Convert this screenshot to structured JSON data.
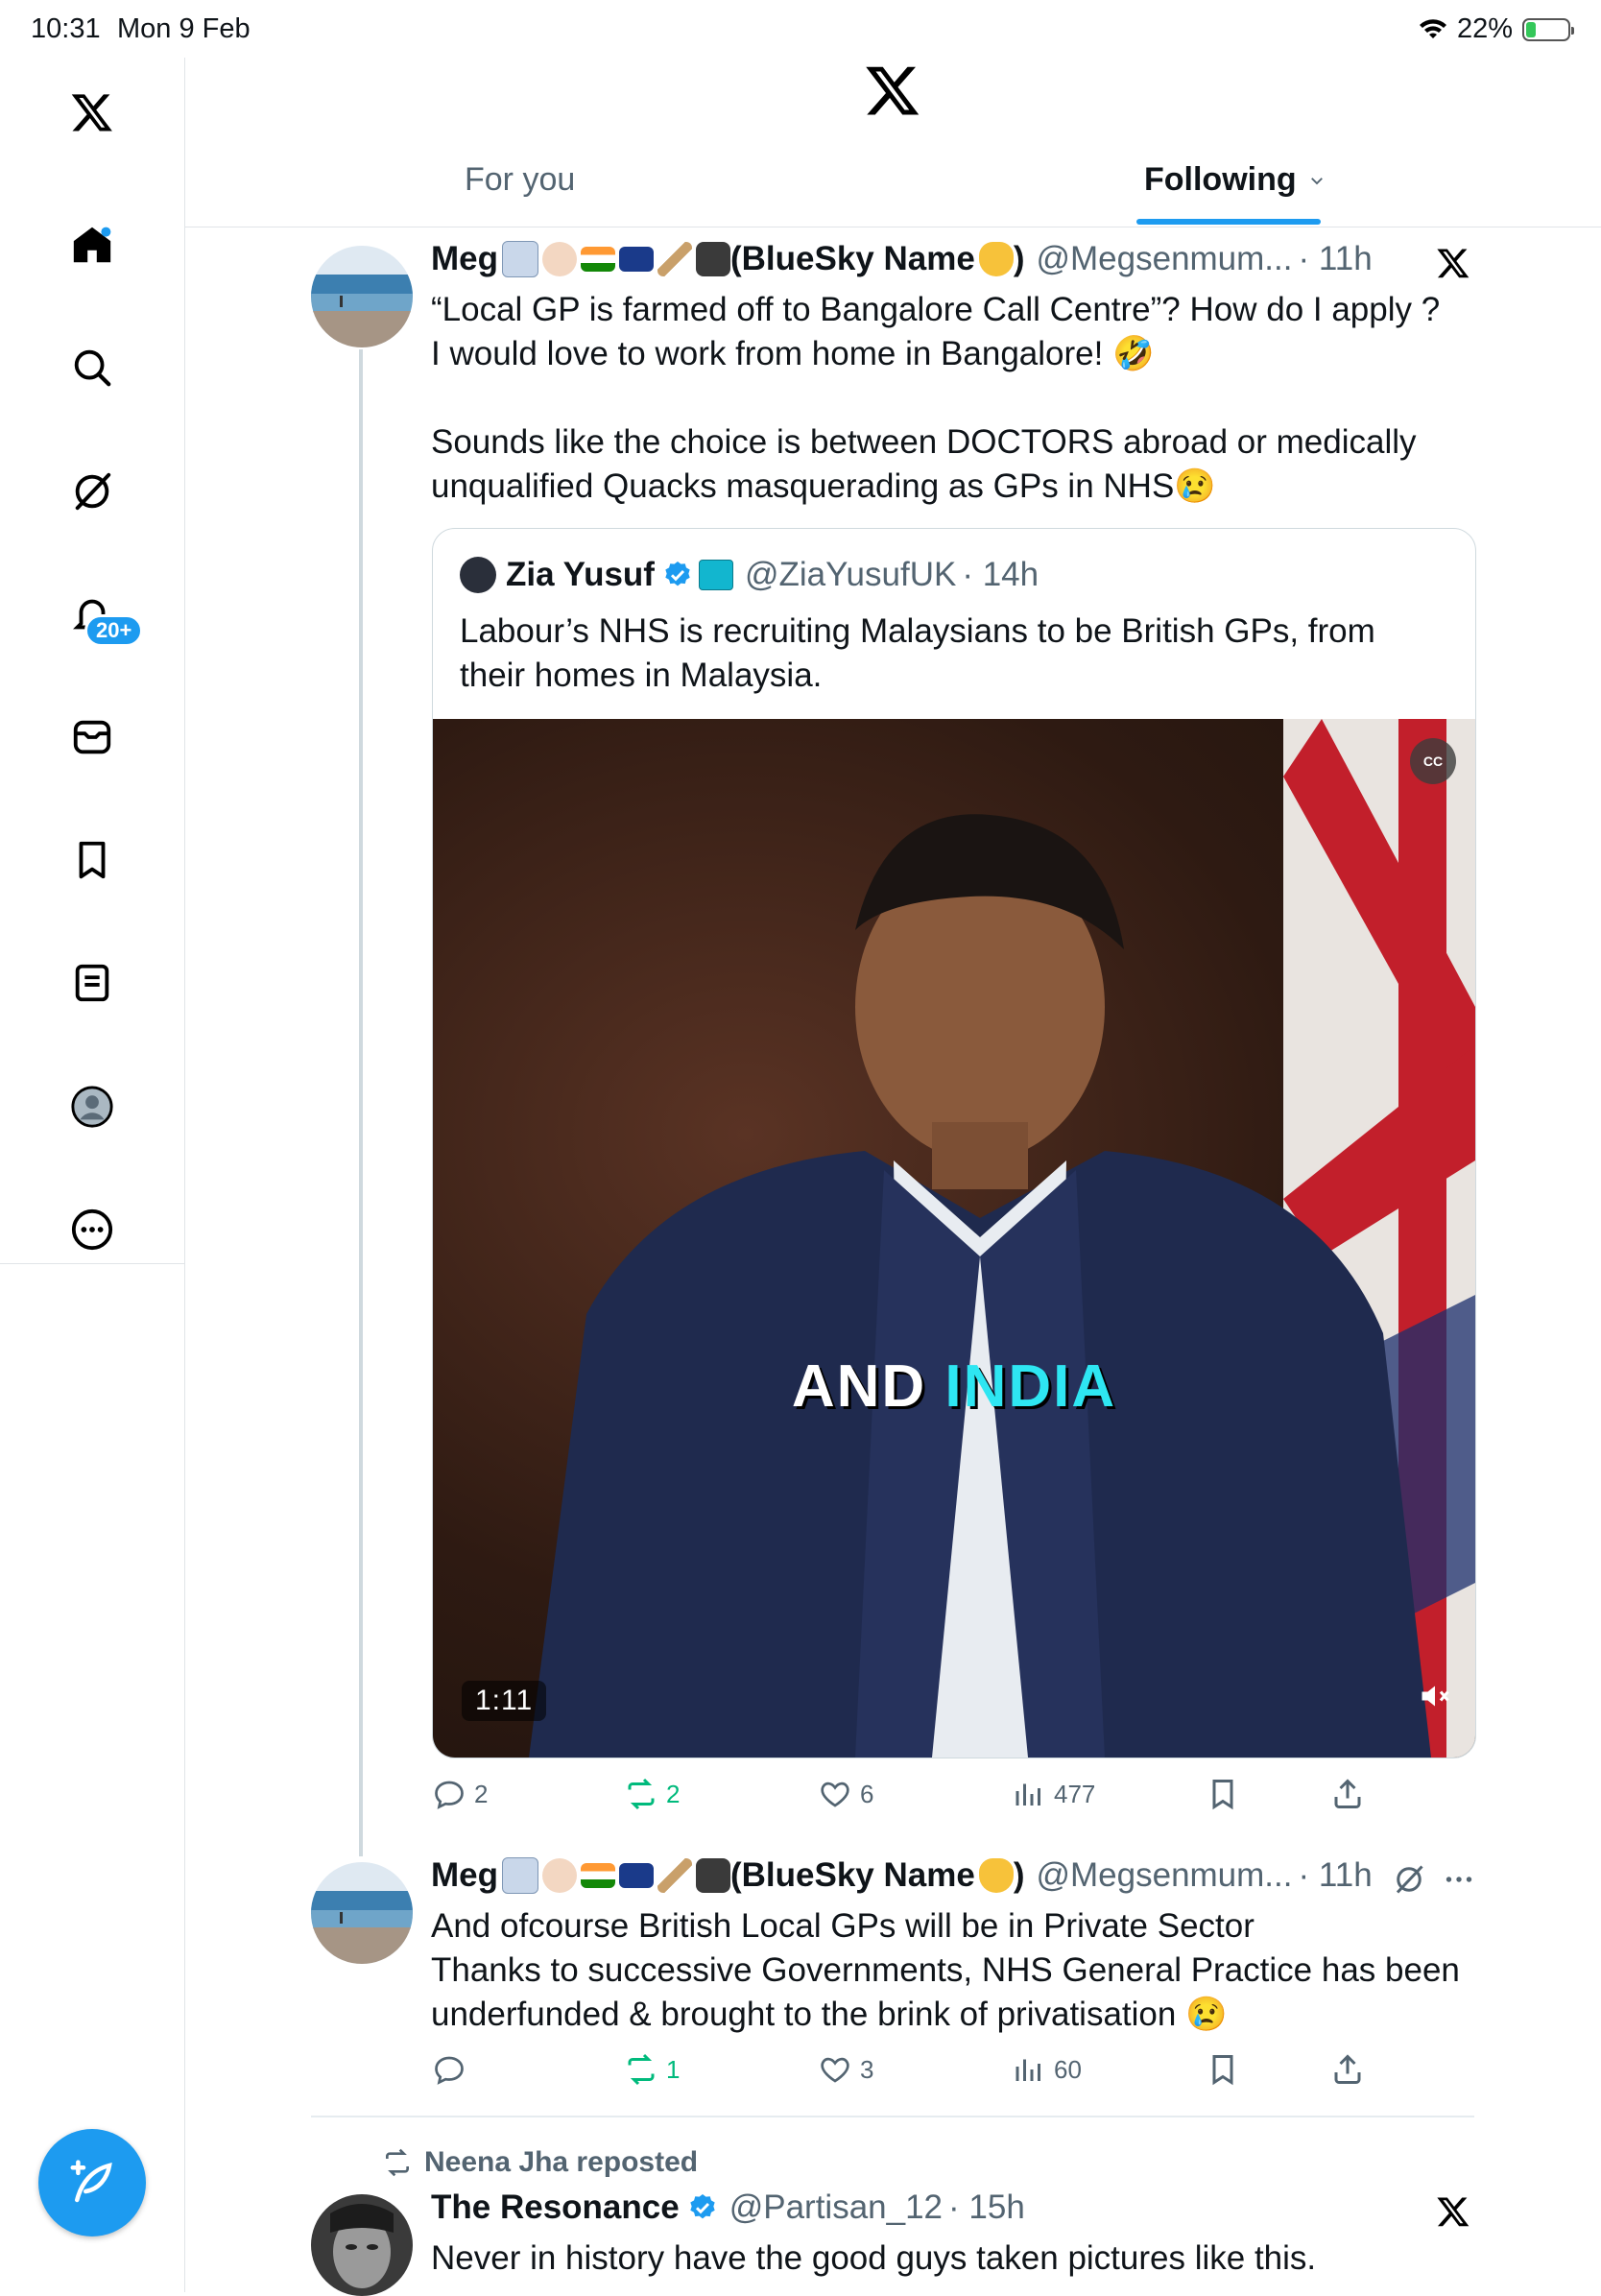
{
  "status_bar": {
    "time": "10:31",
    "date": "Mon 9 Feb",
    "battery": "22%"
  },
  "sidebar": {
    "items": [
      "home",
      "search",
      "grok",
      "notifications",
      "messages",
      "bookmarks",
      "lists",
      "profile",
      "more"
    ],
    "notifications_badge": "20+"
  },
  "header": {
    "tabs": [
      {
        "label": "For you"
      },
      {
        "label": "Following"
      }
    ]
  },
  "tweets": [
    {
      "name": "Meg",
      "name_suffix": "(BlueSky Name",
      "name_close": ")",
      "handle": "@Megsenmum...",
      "time": "· 11h",
      "text": "“Local GP is farmed off to Bangalore Call Centre”? How do I apply ?\nI would love to work from home in Bangalore! 🤣\n\nSounds like the choice is between DOCTORS abroad or medically unqualified Quacks masquerading as GPs in NHS😢",
      "quote": {
        "name": "Zia Yusuf",
        "handle": "@ZiaYusufUK",
        "time": "· 14h",
        "text": "Labour’s NHS is recruiting Malaysians to be British GPs, from their homes in Malaysia.",
        "video": {
          "duration": "1:11",
          "caption_word1": "AND",
          "caption_word2": "INDIA",
          "cc": "CC"
        }
      },
      "stats": {
        "replies": "2",
        "reposts": "2",
        "likes": "6",
        "views": "477"
      }
    },
    {
      "name": "Meg",
      "name_suffix": "(BlueSky Name",
      "name_close": ")",
      "handle": "@Megsenmum...",
      "time": "· 11h",
      "text": "And ofcourse British Local GPs will be in Private Sector\nThanks to successive Governments, NHS General Practice has been underfunded & brought to the brink of privatisation 😢",
      "stats": {
        "replies": "",
        "reposts": "1",
        "likes": "3",
        "views": "60"
      }
    },
    {
      "reposted_by": "Neena Jha reposted",
      "name": "The Resonance",
      "handle": "@Partisan_12",
      "time": "· 15h",
      "text": "Never in history have the good guys taken pictures like this."
    }
  ],
  "colors": {
    "accent": "#1d9bf0",
    "repost_green": "#00ba7c",
    "muted": "#536471"
  }
}
